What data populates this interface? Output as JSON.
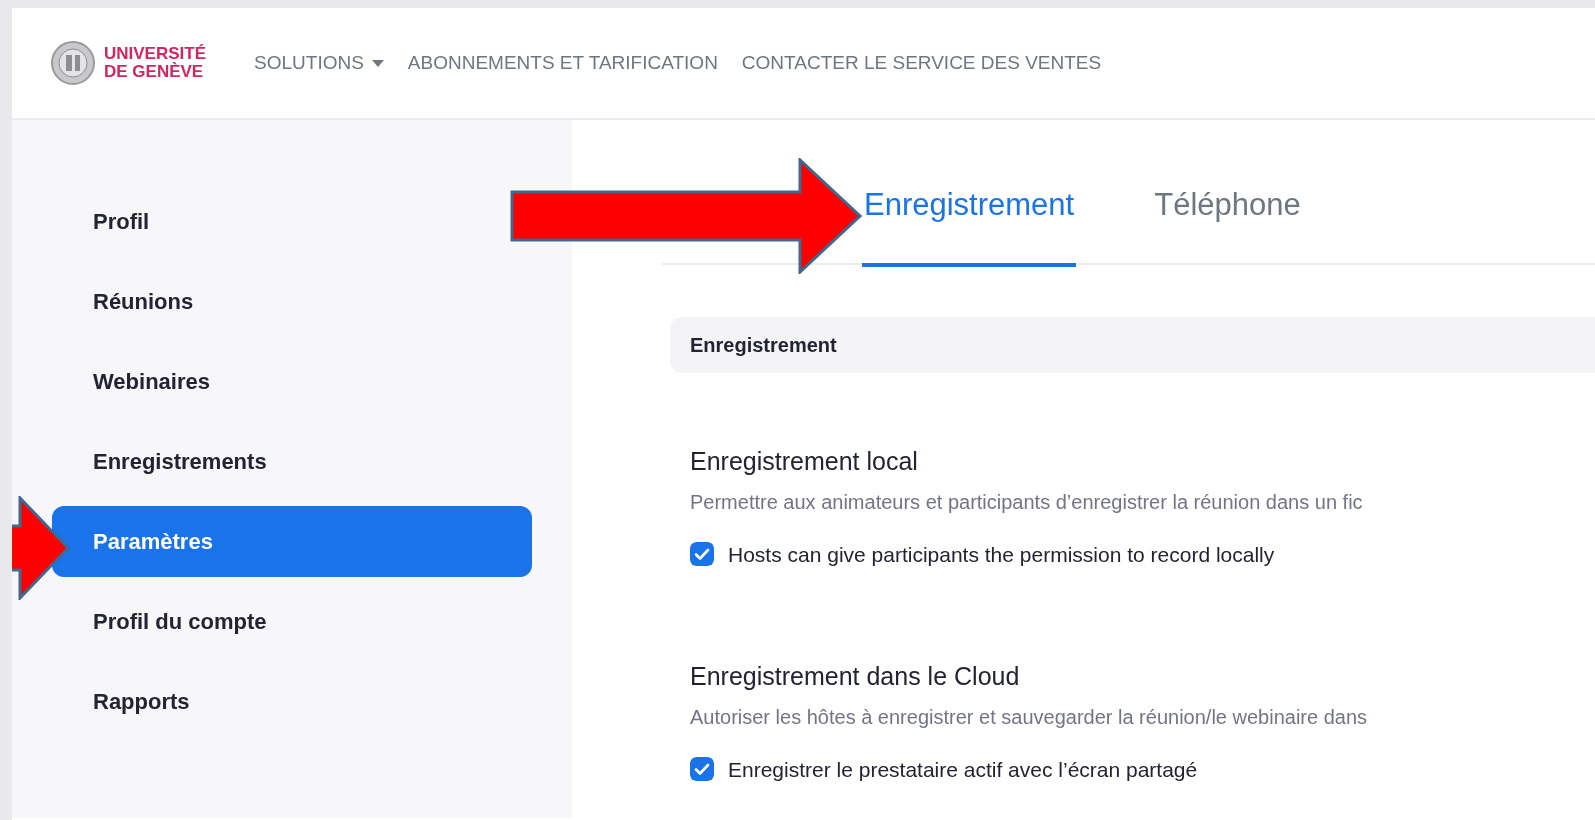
{
  "header": {
    "logo_lines": [
      "UNIVERSITÉ",
      "DE GENÈVE"
    ],
    "nav": [
      {
        "label": "SOLUTIONS",
        "dropdown": true
      },
      {
        "label": "ABONNEMENTS ET TARIFICATION",
        "dropdown": false
      },
      {
        "label": "CONTACTER LE SERVICE DES VENTES",
        "dropdown": false
      }
    ]
  },
  "sidebar": {
    "items": [
      {
        "label": "Profil",
        "selected": false
      },
      {
        "label": "Réunions",
        "selected": false
      },
      {
        "label": "Webinaires",
        "selected": false
      },
      {
        "label": "Enregistrements",
        "selected": false
      },
      {
        "label": "Paramètres",
        "selected": true
      },
      {
        "label": "Profil du compte",
        "selected": false
      },
      {
        "label": "Rapports",
        "selected": false
      }
    ]
  },
  "tabs": [
    {
      "label": "Enregistrement",
      "selected": true
    },
    {
      "label": "Téléphone",
      "selected": false
    }
  ],
  "section_header": "Enregistrement",
  "settings": [
    {
      "title": "Enregistrement local",
      "description": "Permettre aux animateurs et participants d’enregistrer la réunion dans un fic",
      "options": [
        {
          "label": "Hosts can give participants the permission to record locally",
          "checked": true
        }
      ]
    },
    {
      "title": "Enregistrement dans le Cloud",
      "description": "Autoriser les hôtes à enregistrer et sauvegarder la réunion/le webinaire dans",
      "options": [
        {
          "label": "Enregistrer le prestataire actif avec l’écran partagé",
          "checked": true
        }
      ]
    }
  ]
}
